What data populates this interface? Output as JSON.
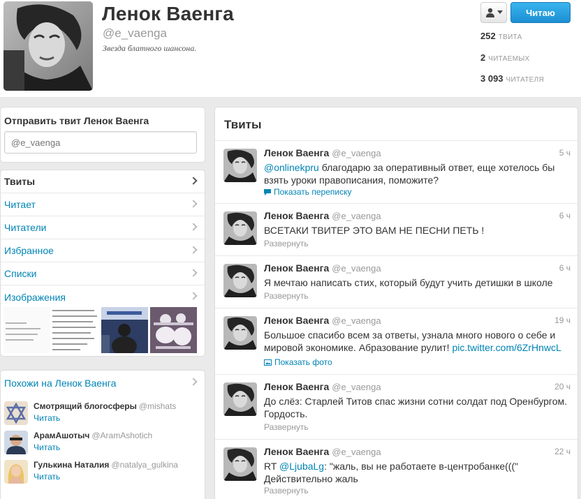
{
  "profile": {
    "name": "Ленок Ваенга",
    "handle": "@e_vaenga",
    "bio": "Звезда блатного шансона.",
    "follow_label": "Читаю",
    "stats": [
      {
        "value": "252",
        "label": "твита"
      },
      {
        "value": "2",
        "label": "читаемых"
      },
      {
        "value": "3 093",
        "label": "читателя"
      }
    ]
  },
  "tweetbox": {
    "title": "Отправить твит Ленок Ваенга",
    "placeholder": "@e_vaenga"
  },
  "nav": {
    "items": [
      {
        "label": "Твиты"
      },
      {
        "label": "Читает"
      },
      {
        "label": "Читатели"
      },
      {
        "label": "Избранное"
      },
      {
        "label": "Списки"
      },
      {
        "label": "Изображения"
      }
    ]
  },
  "similar": {
    "title": "Похожи на Ленок Ваенга",
    "follow_label": "Читать",
    "users": [
      {
        "name": "Смотрящий блогосферы",
        "handle": "@mishats"
      },
      {
        "name": "АрамАшотыч",
        "handle": "@AramAshotich"
      },
      {
        "name": "Гулькина Наталия",
        "handle": "@natalya_gulkina"
      }
    ]
  },
  "stream": {
    "title": "Твиты",
    "tweets": [
      {
        "name": "Ленок Ваенга",
        "handle": "@e_vaenga",
        "time": "5 ч",
        "mention": "@onlinekpru",
        "text": " благодарю за оперативный ответ, еще хотелось бы взять уроки правописания, поможите?",
        "action": "Показать переписку"
      },
      {
        "name": "Ленок Ваенга",
        "handle": "@e_vaenga",
        "time": "6 ч",
        "text": "ВСЕТАКИ ТВИТЕР ЭТО ВАМ НЕ ПЕСНИ ПЕТЬ !",
        "action": "Развернуть"
      },
      {
        "name": "Ленок Ваенга",
        "handle": "@e_vaenga",
        "time": "6 ч",
        "text": "Я мечтаю написать стих, который будут учить детишки в школе",
        "action": "Развернуть"
      },
      {
        "name": "Ленок Ваенга",
        "handle": "@e_vaenga",
        "time": "19 ч",
        "text": "Большое спасибо всем за ответы, узнала много нового о себе и мировой экономике. Абразование рулит! ",
        "link": "pic.twitter.com/6ZrHnwcL",
        "action": "Показать фото"
      },
      {
        "name": "Ленок Ваенга",
        "handle": "@e_vaenga",
        "time": "20 ч",
        "text": "До слёз: Старлей Титов спас жизни сотни солдат под Оренбургом. Гордость.",
        "action": "Развернуть"
      },
      {
        "name": "Ленок Ваенга",
        "handle": "@e_vaenga",
        "time": "22 ч",
        "prefix": "RT ",
        "mention": "@LjubaLg",
        "text": ": \"жаль, вы не работаете в-центробанке(((\" Действительно жаль",
        "action": "Развернуть"
      }
    ]
  },
  "colors": {
    "link": "#0084b4",
    "follow_button": "#1c8fd3",
    "background": "#eaeaea"
  }
}
